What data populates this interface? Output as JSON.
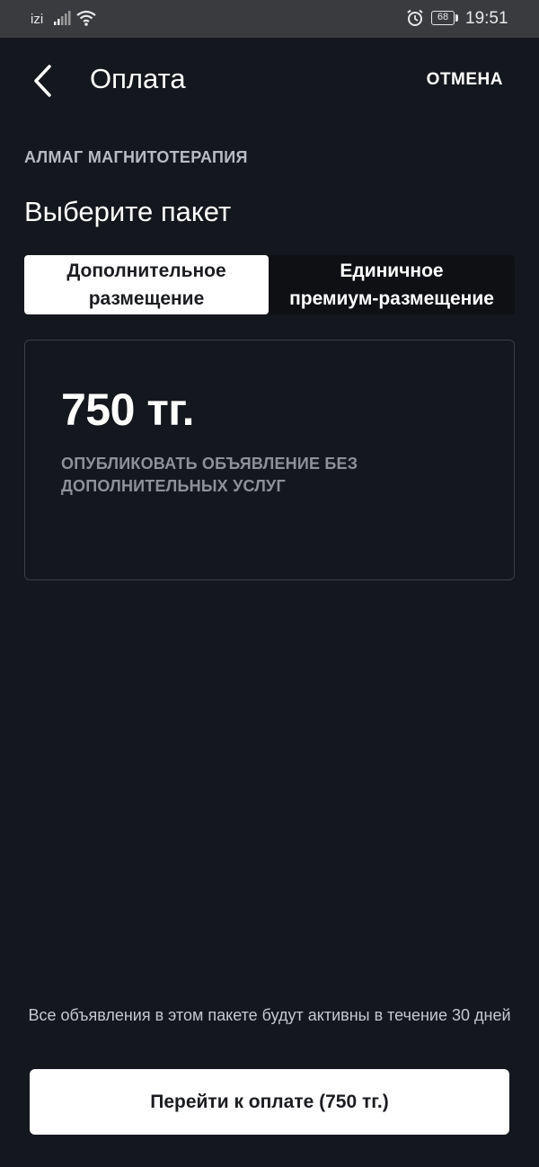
{
  "status_bar": {
    "carrier": "izi",
    "battery": "68",
    "time": "19:51"
  },
  "header": {
    "title": "Оплата",
    "cancel_label": "ОТМЕНА"
  },
  "product": {
    "name": "АЛМАГ МАГНИТОТЕРАПИЯ"
  },
  "section": {
    "title": "Выберите пакет"
  },
  "tabs": [
    {
      "line1": "Дополнительное",
      "line2": "размещение",
      "active": true
    },
    {
      "line1": "Единичное",
      "line2": "премиум-размещение",
      "active": false
    }
  ],
  "package": {
    "price": "750 тг.",
    "description": "ОПУБЛИКОВАТЬ ОБЪЯВЛЕНИЕ БЕЗ ДОПОЛНИТЕЛЬНЫХ УСЛУГ"
  },
  "footer": {
    "note": "Все объявления в этом пакете будут активны в течение 30 дней",
    "pay_label": "Перейти к оплате (750 тг.)"
  },
  "colors": {
    "background": "#15171e",
    "status_bar": "#3a3b3f",
    "muted_text": "#8e9198"
  },
  "icons": [
    "signal-icon",
    "wifi-icon",
    "alarm-icon",
    "battery-icon",
    "back-arrow-icon"
  ]
}
